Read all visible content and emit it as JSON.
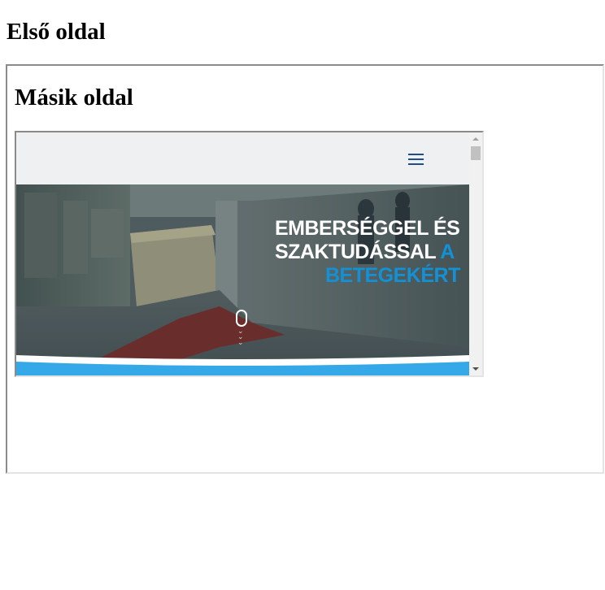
{
  "outer_page": {
    "title": "Első oldal"
  },
  "inner_page": {
    "title": "Másik oldal"
  },
  "embedded_site": {
    "header": {
      "menu_icon": "hamburger-menu-icon"
    },
    "hero": {
      "headline_line1": "EMBERSÉGGEL ÉS",
      "headline_line2_white": "SZAKTUDÁSSAL",
      "headline_line2_blue": " A",
      "headline_line3": "BETEGEKÉRT",
      "scroll_icon": "scroll-down-mouse-icon"
    },
    "colors": {
      "header_bg": "#eff0f2",
      "accent_blue": "#1391d6",
      "wave_blue": "#35a9e8",
      "menu_icon": "#1f4d86"
    }
  }
}
